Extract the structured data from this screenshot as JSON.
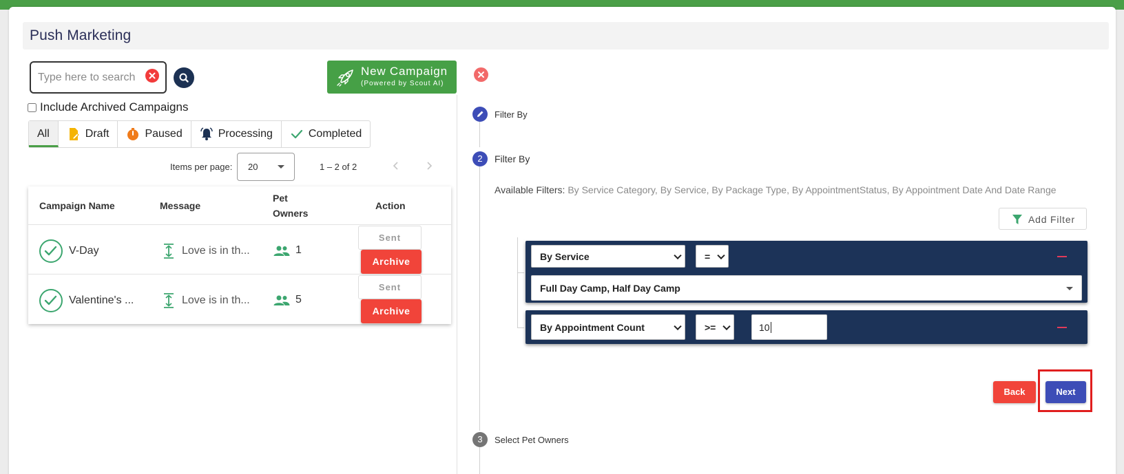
{
  "header": {
    "title": "Push Marketing"
  },
  "search": {
    "placeholder": "Type here to search"
  },
  "new_campaign": {
    "title": "New Campaign",
    "subtitle": "(Powered by Scout AI)"
  },
  "archived": {
    "label": "Include Archived Campaigns",
    "checked": false
  },
  "tabs": [
    {
      "label": "All",
      "icon": "none",
      "active": true
    },
    {
      "label": "Draft",
      "icon": "draft-doc-icon",
      "color": "#f5b400"
    },
    {
      "label": "Paused",
      "icon": "timer-icon",
      "color": "#f07b1a"
    },
    {
      "label": "Processing",
      "icon": "bell-icon",
      "color": "#1c3153"
    },
    {
      "label": "Completed",
      "icon": "check-icon",
      "color": "#3ca66f"
    }
  ],
  "paginator": {
    "items_per_page_label": "Items per page:",
    "items_per_page_value": "20",
    "range": "1 – 2 of 2"
  },
  "table": {
    "headers": {
      "name": "Campaign Name",
      "message": "Message",
      "owners_line1": "Pet",
      "owners_line2": "Owners",
      "action": "Action"
    },
    "rows": [
      {
        "name": "V-Day",
        "message": "Love is in th...",
        "owners": "1",
        "status_button": "Sent",
        "archive_button": "Archive"
      },
      {
        "name": "Valentine's ...",
        "message": "Love is in th...",
        "owners": "5",
        "status_button": "Sent",
        "archive_button": "Archive"
      }
    ]
  },
  "stepper": {
    "step1_label": "Filter By",
    "step2_number": "2",
    "step2_label": "Filter By",
    "step3_number": "3",
    "step3_label": "Select Pet Owners"
  },
  "filters": {
    "available_label": "Available Filters:",
    "available_list": "By Service Category, By Service, By Package Type, By AppointmentStatus, By Appointment Date And Date Range",
    "add_filter_label": "Add Filter",
    "group1": {
      "field": "By Service",
      "operator": "=",
      "value": "Full Day Camp, Half Day Camp"
    },
    "group2": {
      "field": "By Appointment Count",
      "operator": ">=",
      "value": "10"
    }
  },
  "buttons": {
    "back": "Back",
    "next": "Next"
  },
  "colors": {
    "brand_green": "#4a9f47",
    "navy": "#1c3358",
    "danger": "#f1443a",
    "primary": "#3d4db7"
  }
}
